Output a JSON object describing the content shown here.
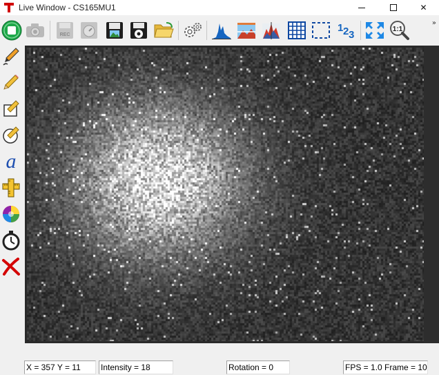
{
  "window": {
    "title": "Live Window - CS165MU1",
    "minimize_icon": "minimize-icon",
    "maximize_icon": "maximize-icon",
    "close_glyph": "✕"
  },
  "toolbar": {
    "items": [
      {
        "name": "stop-live-button",
        "icon": "stop-icon",
        "enabled": true
      },
      {
        "name": "snapshot-button",
        "icon": "camera-icon",
        "enabled": false
      },
      {
        "name": "record-button",
        "icon": "record-icon",
        "enabled": false
      },
      {
        "name": "timer-capture-button",
        "icon": "stopwatch-icon",
        "enabled": false
      },
      {
        "name": "save-image-button",
        "icon": "save-image-icon",
        "enabled": true
      },
      {
        "name": "save-settings-button",
        "icon": "save-gear-icon",
        "enabled": true
      },
      {
        "name": "open-file-button",
        "icon": "open-folder-icon",
        "enabled": true
      },
      {
        "name": "camera-settings-button",
        "icon": "gears-icon",
        "enabled": true
      },
      {
        "name": "histogram-button",
        "icon": "histogram-icon",
        "enabled": true
      },
      {
        "name": "line-profile-button",
        "icon": "line-profile-icon",
        "enabled": true
      },
      {
        "name": "color-profile-button",
        "icon": "color-profile-icon",
        "enabled": true
      },
      {
        "name": "grid-button",
        "icon": "grid-icon",
        "enabled": true
      },
      {
        "name": "roi-button",
        "icon": "roi-dashed-icon",
        "enabled": true
      },
      {
        "name": "pixel-values-button",
        "icon": "pixel-values-icon",
        "enabled": true
      },
      {
        "name": "fit-to-window-button",
        "icon": "fit-arrows-icon",
        "enabled": true
      },
      {
        "name": "zoom-1-1-button",
        "icon": "zoom-1-1-icon",
        "enabled": true
      }
    ],
    "overflow_glyph": "»",
    "pixel_values_label": "123",
    "zoom_label": "1:1"
  },
  "left_tools": [
    {
      "name": "pen-tool",
      "icon": "pen-icon"
    },
    {
      "name": "pencil-tool",
      "icon": "pencil-icon"
    },
    {
      "name": "rectangle-tool",
      "icon": "rectangle-pencil-icon"
    },
    {
      "name": "ellipse-tool",
      "icon": "ellipse-pencil-icon"
    },
    {
      "name": "text-tool",
      "icon": "text-a-icon",
      "glyph": "a"
    },
    {
      "name": "ruler-tool",
      "icon": "ruler-icon"
    },
    {
      "name": "color-tool",
      "icon": "color-wheel-icon"
    },
    {
      "name": "timer-tool",
      "icon": "stopwatch-icon"
    },
    {
      "name": "delete-tool",
      "icon": "red-x-icon"
    }
  ],
  "image": {
    "description_icon": "live-camera-image",
    "background": "#1c1c1c"
  },
  "status": {
    "xy": "X = 357  Y = 11",
    "intensity": "Intensity = 18",
    "rotation": "Rotation = 0",
    "fps": "FPS = 1.0  Frame = 10"
  },
  "colors": {
    "accent_red": "#d10000",
    "stop_green": "#1fa84a",
    "toolbar_blue": "#1565c0"
  }
}
